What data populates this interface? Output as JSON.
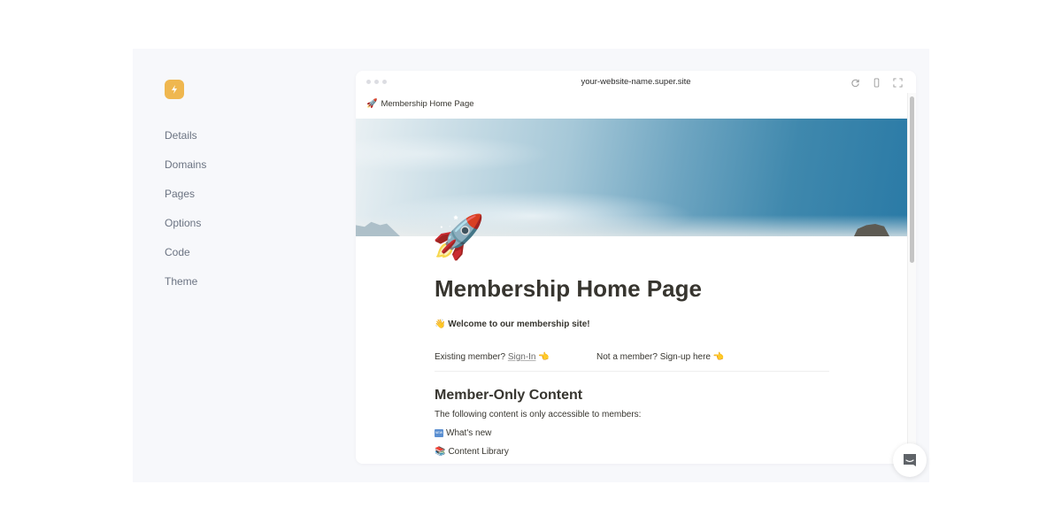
{
  "app": {
    "logo_icon": "lightning-bolt-icon",
    "accent_color": "#efb74f"
  },
  "sidebar": {
    "items": [
      {
        "label": "Details"
      },
      {
        "label": "Domains"
      },
      {
        "label": "Pages"
      },
      {
        "label": "Options"
      },
      {
        "label": "Code"
      },
      {
        "label": "Theme"
      }
    ]
  },
  "browser": {
    "url": "your-website-name.super.site",
    "icons": [
      "refresh-icon",
      "mobile-preview-icon",
      "expand-icon"
    ]
  },
  "page": {
    "crumb_emoji": "🚀",
    "crumb_title": "Membership Home Page",
    "icon_emoji": "🚀",
    "title": "Membership Home Page",
    "welcome_emoji": "👋",
    "welcome_text": "Welcome to our membership site!",
    "existing_prefix": "Existing member?",
    "signin_link": "Sign-In",
    "pointing_emoji": "👈",
    "signup_text": "Not a member? Sign-up here",
    "section_heading": "Member-Only Content",
    "section_text": "The following content is only accessible to members:",
    "list": [
      {
        "emoji": "NEW",
        "label": "What's new"
      },
      {
        "emoji": "📚",
        "label": "Content Library"
      }
    ]
  },
  "chat_widget": {
    "icon": "chat-support-icon"
  }
}
